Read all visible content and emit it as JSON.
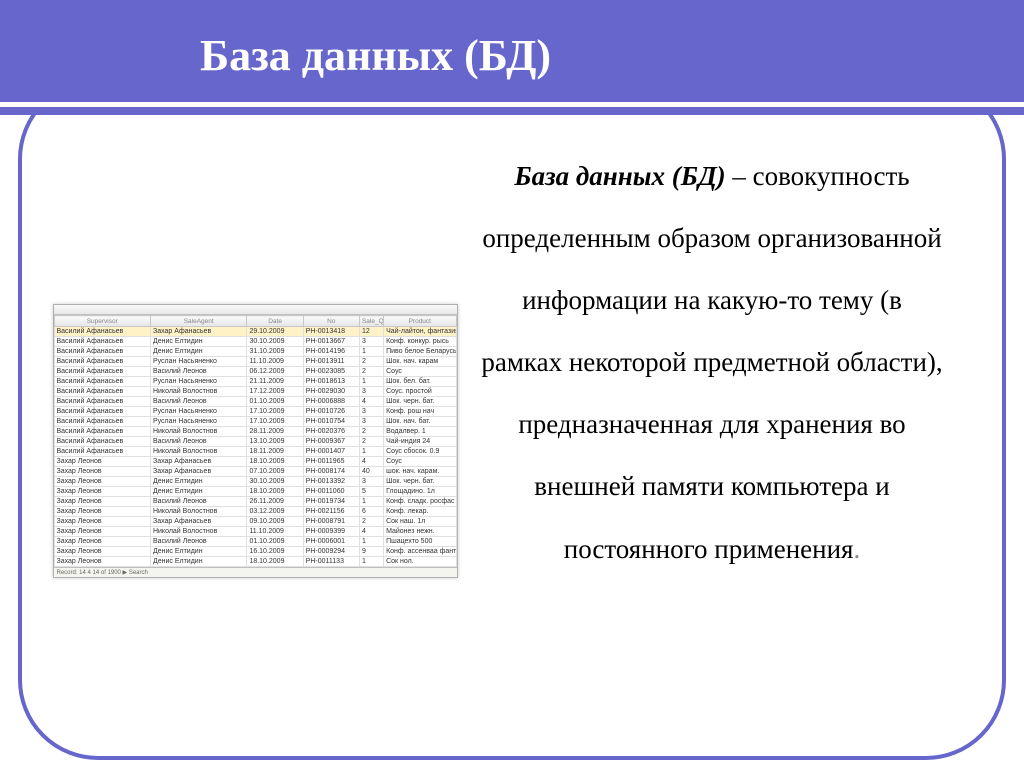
{
  "header": {
    "title": "База данных (БД)"
  },
  "body": {
    "term": "База данных (БД)",
    "definition_tail": " – совокупность определенным образом организованной информации на какую-то тему (в рамках некоторой предметной области), предназначенная для хранения во внешней памяти компьютера и постоянного применения",
    "period": "."
  },
  "table": {
    "columns": [
      "Supervisor",
      "SaleAgent",
      "Date",
      "No",
      "Sale_Qty",
      "Product"
    ],
    "rows": [
      [
        "Василий Афанасьев",
        "Захар Афанасьев",
        "29.10.2009",
        "PH-0013418",
        "12",
        "Чай-лайтон, фантазия"
      ],
      [
        "Василий Афанасьев",
        "Денис Елтидин",
        "30.10.2009",
        "PH-0013667",
        "3",
        "Конф. конкур. рысь"
      ],
      [
        "Василий Афанасьев",
        "Денис Елтидин",
        "31.10.2009",
        "PH-0014196",
        "1",
        "Пиво белое Беларусь"
      ],
      [
        "Василий Афанасьев",
        "Руслан Насьяненко",
        "11.10.2009",
        "PH-0013911",
        "2",
        "Шок. нач. карам"
      ],
      [
        "Василий Афанасьев",
        "Василий Леонов",
        "06.12.2009",
        "PH-0023085",
        "2",
        "Соус"
      ],
      [
        "Василий Афанасьев",
        "Руслан Насьяненко",
        "21.11.2009",
        "PH-0018613",
        "1",
        "Шок. бел. бат."
      ],
      [
        "Василий Афанасьев",
        "Николай Волостнов",
        "17.12.2009",
        "PH-0029030",
        "3",
        "Соус. простой"
      ],
      [
        "Василий Афанасьев",
        "Василий Леонов",
        "01.10.2009",
        "PH-0006888",
        "4",
        "Шок. черн. бат."
      ],
      [
        "Василий Афанасьев",
        "Руслан Насьяненко",
        "17.10.2009",
        "PH-0010726",
        "3",
        "Конф. рош нач"
      ],
      [
        "Василий Афанасьев",
        "Руслан Насьяненко",
        "17.10.2009",
        "PH-0010754",
        "3",
        "Шок. нач. бат."
      ],
      [
        "Василий Афанасьев",
        "Николай Волостнов",
        "28.11.2009",
        "PH-0020376",
        "2",
        "Водалвер. 1"
      ],
      [
        "Василий Афанасьев",
        "Василий Леонов",
        "13.10.2009",
        "PH-0009367",
        "2",
        "Чай-индия 24"
      ],
      [
        "Василий Афанасьев",
        "Николай Волостнов",
        "18.11.2009",
        "PH-0001407",
        "1",
        "Соус сбосок. 0.9"
      ],
      [
        "Захар Леонов",
        "Захар Афанасьев",
        "18.10.2009",
        "PH-0011965",
        "4",
        "Соус"
      ],
      [
        "Захар Леонов",
        "Захар Афанасьев",
        "07.10.2009",
        "PH-0008174",
        "40",
        "шок. нач. карам."
      ],
      [
        "Захар Леонов",
        "Денис Елтидин",
        "30.10.2009",
        "PH-0013392",
        "3",
        "Шок. черн. бат."
      ],
      [
        "Захар Леонов",
        "Денис Елтидин",
        "18.10.2009",
        "PH-0011060",
        "5",
        "Глощадино. 1л"
      ],
      [
        "Захар Леонов",
        "Василий Леонов",
        "26.11.2009",
        "PH-0019734",
        "1",
        "Конф. сладк. росфас"
      ],
      [
        "Захар Леонов",
        "Николай Волостнов",
        "03.12.2009",
        "PH-0021156",
        "6",
        "Конф. лекар."
      ],
      [
        "Захар Леонов",
        "Захар Афанасьев",
        "09.10.2009",
        "PH-0008791",
        "2",
        "Сок наш. 1л"
      ],
      [
        "Захар Леонов",
        "Николай Волостнов",
        "11.10.2009",
        "PH-0009399",
        "4",
        "Майонез нежн."
      ],
      [
        "Захар Леонов",
        "Василий Леонов",
        "01.10.2009",
        "PH-0006001",
        "1",
        "Пшацехто 500"
      ],
      [
        "Захар Леонов",
        "Денис Елтидин",
        "16.10.2009",
        "PH-0009294",
        "9",
        "Конф. ассенваа фант."
      ],
      [
        "Захар Леонов",
        "Денис Елтидин",
        "18.10.2009",
        "PH-0011133",
        "1",
        "Сок нол."
      ]
    ],
    "footer": "Record: 14   4  14 of 1900   ▶   Search"
  }
}
